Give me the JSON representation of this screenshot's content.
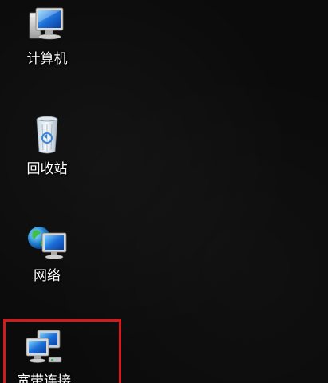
{
  "desktop": {
    "icons": [
      {
        "label": "计算机",
        "icon": "computer-icon"
      },
      {
        "label": "回收站",
        "icon": "recycle-bin-icon"
      },
      {
        "label": "网络",
        "icon": "network-icon"
      },
      {
        "label": "宽带连接",
        "icon": "broadband-connection-icon"
      }
    ]
  },
  "colors": {
    "background": "#0b0b0b",
    "label_text": "#ffffff",
    "highlight_border": "#d41a1a"
  }
}
